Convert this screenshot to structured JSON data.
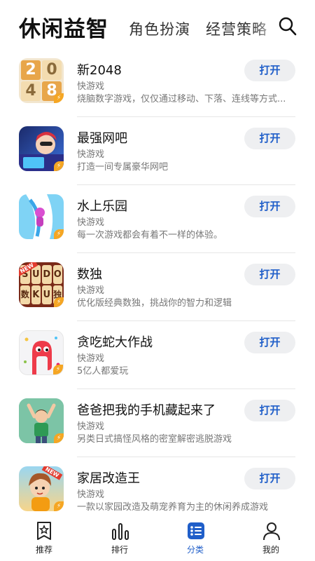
{
  "header": {
    "tabs": [
      {
        "label": "休闲益智"
      },
      {
        "label": "角色扮演"
      },
      {
        "label": "经营策略"
      }
    ]
  },
  "apps": [
    {
      "title": "新2048",
      "subtitle": "快游戏",
      "description": "烧脑数字游戏，仅仅通过移动、下落、连线等方式...",
      "button": "打开",
      "icon": "2048-tiles-icon"
    },
    {
      "title": "最强网吧",
      "subtitle": "快游戏",
      "description": "打造一间专属豪华网吧",
      "button": "打开",
      "icon": "gamer-character-icon"
    },
    {
      "title": "水上乐园",
      "subtitle": "快游戏",
      "description": "每一次游戏都会有着不一样的体验。",
      "button": "打开",
      "icon": "water-slide-icon"
    },
    {
      "title": "数独",
      "subtitle": "快游戏",
      "description": "优化版经典数独，挑战你的智力和逻辑",
      "button": "打开",
      "icon": "sudoku-tiles-icon",
      "icon_text": [
        "S",
        "U",
        "D",
        "O",
        "数",
        "K",
        "U",
        "独"
      ],
      "icon_badge": "NEW"
    },
    {
      "title": "贪吃蛇大作战",
      "subtitle": "快游戏",
      "description": "5亿人都爱玩",
      "button": "打开",
      "icon": "snake-icon"
    },
    {
      "title": "爸爸把我的手机藏起来了",
      "subtitle": "快游戏",
      "description": "另类日式搞怪风格的密室解密逃脱游戏",
      "button": "打开",
      "icon": "boy-character-icon"
    },
    {
      "title": "家居改造王",
      "subtitle": "快游戏",
      "description": "一款以家园改造及萌宠养育为主的休闲养成游戏",
      "button": "打开",
      "icon": "home-girl-icon",
      "icon_badge": "NEW"
    }
  ],
  "icon_tile_digits": [
    "2",
    "0",
    "4",
    "8"
  ],
  "bottom_nav": [
    {
      "label": "推荐",
      "icon": "recommend-icon"
    },
    {
      "label": "排行",
      "icon": "ranking-icon"
    },
    {
      "label": "分类",
      "icon": "category-icon",
      "active": true
    },
    {
      "label": "我的",
      "icon": "profile-icon"
    }
  ],
  "colors": {
    "accent": "#1f5ec9",
    "button_bg": "#eeeff1",
    "quick_badge": "#f5a623"
  }
}
